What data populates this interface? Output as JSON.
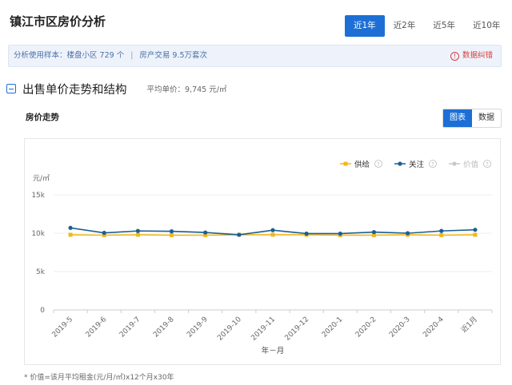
{
  "header": {
    "title": "镇江市区房价分析",
    "range_tabs": [
      "近1年",
      "近2年",
      "近5年",
      "近10年"
    ],
    "active_range": "近1年"
  },
  "sample": {
    "text_a": "分析使用样本：",
    "text_b": "楼盘小区 729 个",
    "separator": "|",
    "text_c": "房产交易 9.5万套次",
    "report_label": "数据纠错",
    "report_icon": "exclamation-circle-icon"
  },
  "section": {
    "title": "出售单价走势和结构",
    "avg_label": "平均单价：",
    "avg_value": "9,745 元/㎡",
    "toggle_icon": "collapse-minus-icon"
  },
  "trend": {
    "label": "房价走势",
    "view_buttons": [
      "图表",
      "数据"
    ],
    "active_view": "图表"
  },
  "chart_data": {
    "type": "line",
    "ylabel": "元/㎡",
    "xlabel": "年－月",
    "ylim": [
      0,
      15000
    ],
    "yticks": [
      0,
      5000,
      10000,
      15000
    ],
    "ytick_labels": [
      "0",
      "5k",
      "10k",
      "15k"
    ],
    "categories": [
      "2019-5",
      "2019-6",
      "2019-7",
      "2019-8",
      "2019-9",
      "2019-10",
      "2019-11",
      "2019-12",
      "2020-1",
      "2020-2",
      "2020-3",
      "2020-4",
      "近1月"
    ],
    "grid": true,
    "legend_position": "top-right",
    "series": [
      {
        "name": "供给",
        "color": "#f0b81c",
        "values": [
          9800,
          9750,
          9800,
          9750,
          9750,
          9800,
          9800,
          9800,
          9750,
          9750,
          9800,
          9750,
          9800
        ],
        "visible": true
      },
      {
        "name": "关注",
        "color": "#1a5f95",
        "values": [
          10700,
          10050,
          10300,
          10250,
          10100,
          9800,
          10400,
          9950,
          9950,
          10150,
          10000,
          10300,
          10450
        ],
        "visible": true
      },
      {
        "name": "价值",
        "color": "#c8c8c8",
        "values": [],
        "visible": false
      }
    ],
    "legend_help_icon": "question-circle-icon"
  },
  "footnote": "* 价值=该月平均租金(元/月/㎡)x12个月x30年"
}
